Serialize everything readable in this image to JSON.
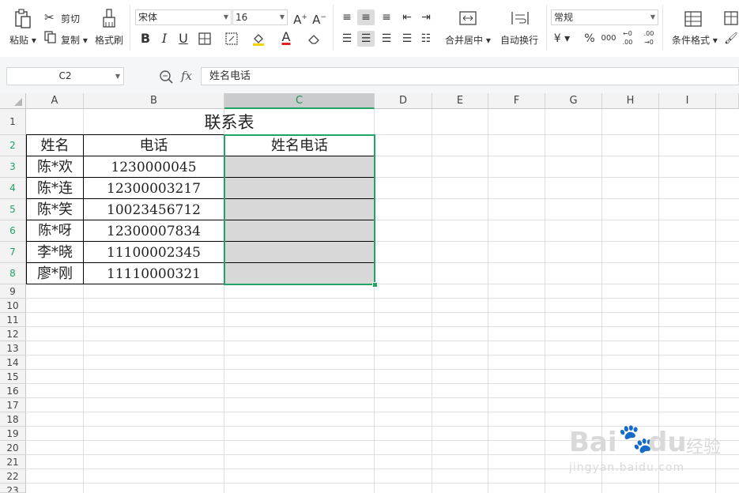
{
  "ribbon": {
    "paste_label": "粘贴",
    "cut_label": "剪切",
    "copy_label": "复制",
    "format_painter_label": "格式刷",
    "font_name": "宋体",
    "font_size": "16",
    "bold": "B",
    "italic": "I",
    "underline": "U",
    "increase_font": "A⁺",
    "decrease_font": "A⁻",
    "font_color_letter": "A",
    "merge_center_label": "合并居中",
    "wrap_text_label": "自动换行",
    "number_format": "常规",
    "currency": "¥",
    "percent": "%",
    "thousands": "000",
    "inc_decimal": "←0 .00",
    "dec_decimal": ".00 →0",
    "conditional_format_label": "条件格式"
  },
  "formula_bar": {
    "cell_ref": "C2",
    "fx": "fx",
    "content": "姓名电话"
  },
  "columns": [
    "A",
    "B",
    "C",
    "D",
    "E",
    "F",
    "G",
    "H",
    "I"
  ],
  "rows": [
    "1",
    "2",
    "3",
    "4",
    "5",
    "6",
    "7",
    "8",
    "9",
    "10",
    "11",
    "12",
    "13",
    "14",
    "15",
    "16",
    "17",
    "18",
    "19",
    "20",
    "21",
    "22",
    "23"
  ],
  "sheet": {
    "title": "联系表",
    "headers": [
      "姓名",
      "电话",
      "姓名电话"
    ],
    "rows": [
      [
        "陈*欢",
        "1230000045",
        ""
      ],
      [
        "陈*连",
        "12300003217",
        ""
      ],
      [
        "陈*笑",
        "10023456712",
        ""
      ],
      [
        "陈*呀",
        "12300007834",
        ""
      ],
      [
        "李*晓",
        "11100002345",
        ""
      ],
      [
        "廖*刚",
        "11110000321",
        ""
      ]
    ]
  },
  "active_cell": "C2",
  "colors": {
    "accent": "#21a366",
    "selection_fill": "#d8d8d8"
  },
  "watermark": {
    "brand": "Bai",
    "brand2": "du",
    "cn": "经验",
    "url": "jingyan.baidu.com"
  }
}
